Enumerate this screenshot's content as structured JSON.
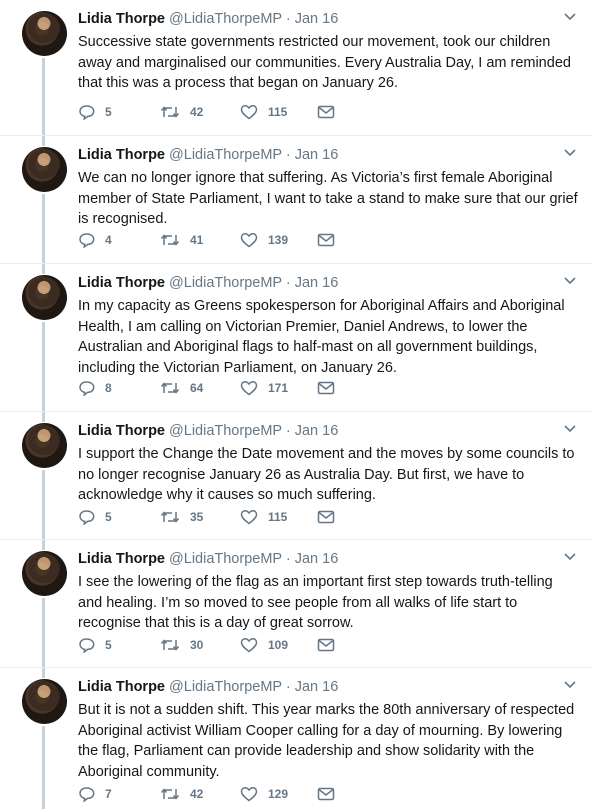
{
  "author": {
    "name": "Lidia Thorpe",
    "handle": "@LidiaThorpeMP",
    "separator": "·"
  },
  "tweets": [
    {
      "date": "Jan 16",
      "text": "Successive state governments restricted our movement, took our children away and marginalised our communities. Every Australia Day, I am reminded that this was a process that began on January 26.",
      "replies": "5",
      "retweets": "42",
      "likes": "115"
    },
    {
      "date": "Jan 16",
      "text": "We can no longer ignore that suffering. As Victoria’s first female Aboriginal member of State Parliament, I want to take a stand to make sure that our grief is recognised.",
      "replies": "4",
      "retweets": "41",
      "likes": "139"
    },
    {
      "date": "Jan 16",
      "text": "In my capacity as Greens spokesperson for Aboriginal Affairs and Aboriginal Health, I am calling on Victorian Premier, Daniel Andrews, to lower the Australian and Aboriginal flags to half-mast on all government buildings, including the Victorian Parliament, on January 26.",
      "replies": "8",
      "retweets": "64",
      "likes": "171"
    },
    {
      "date": "Jan 16",
      "text": "I support the Change the Date movement and the moves by some councils to no longer recognise January 26 as Australia Day. But first, we have to acknowledge why it causes so much suffering.",
      "replies": "5",
      "retweets": "35",
      "likes": "115"
    },
    {
      "date": "Jan 16",
      "text": "I see the lowering of the flag as an important first step towards truth-telling and healing. I’m so moved to see people from all walks of life start to recognise that this is a day of great sorrow.",
      "replies": "5",
      "retweets": "30",
      "likes": "109"
    },
    {
      "date": "Jan 16",
      "text": "But it is not a sudden shift. This year marks the 80th anniversary of respected Aboriginal activist William Cooper calling for a day of mourning. By lowering the flag, Parliament can provide leadership and show solidarity with the Aboriginal community.",
      "replies": "7",
      "retweets": "42",
      "likes": "129"
    }
  ],
  "icons": [
    "reply-icon",
    "retweet-icon",
    "like-icon",
    "direct-message-icon",
    "chevron-down-icon"
  ],
  "colors": {
    "text": "#14171a",
    "muted": "#657786",
    "thread": "#c6d2da",
    "divider": "#e6ecf0"
  }
}
